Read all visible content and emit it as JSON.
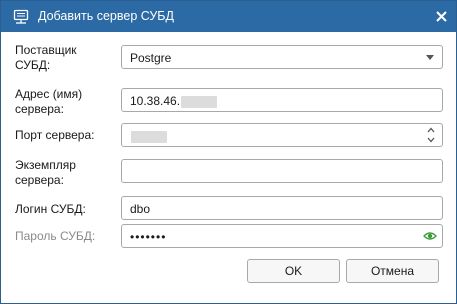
{
  "window": {
    "title": "Добавить сервер СУБД",
    "icon": "database-server-icon",
    "close_icon": "close-icon"
  },
  "form": {
    "vendor": {
      "label": "Поставщик\nСУБД:",
      "value": "Postgre",
      "icon": "chevron-down-icon"
    },
    "address": {
      "label": "Адрес (имя)\nсервера:",
      "value": "10.38.46."
    },
    "port": {
      "label": "Порт сервера:",
      "value": ""
    },
    "instance": {
      "label": "Экземпляр\nсервера:",
      "value": ""
    },
    "login": {
      "label": "Логин СУБД:",
      "value": "dbo"
    },
    "password": {
      "label": "Пароль СУБД:",
      "value": "•••••••",
      "icon": "eye-icon"
    }
  },
  "buttons": {
    "ok_label": "OK",
    "cancel_label": "Отмена"
  },
  "colors": {
    "titlebar": "#2c6aa6",
    "accent_green": "#3a9a3a"
  }
}
